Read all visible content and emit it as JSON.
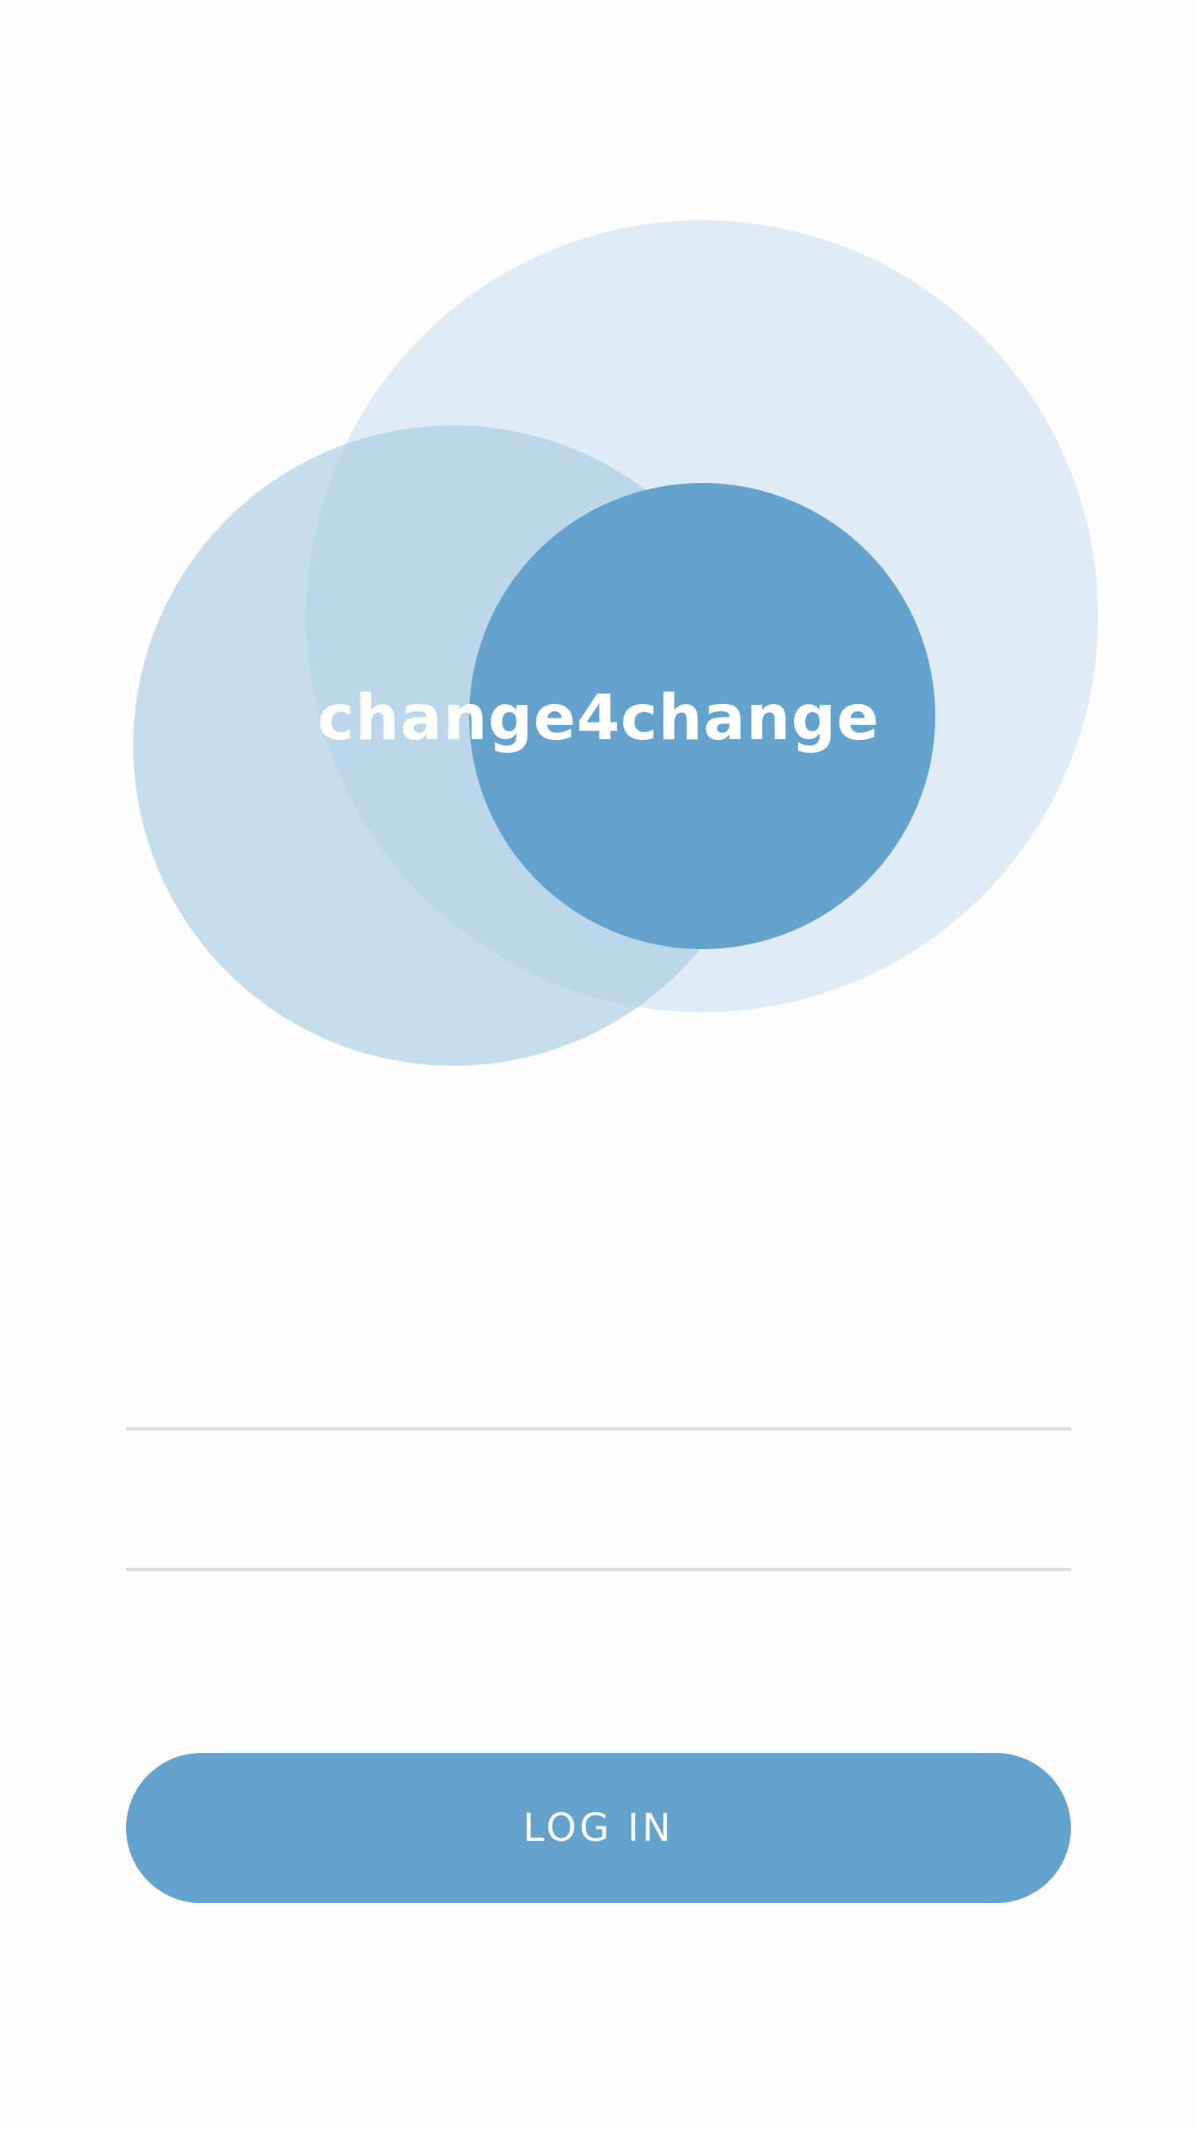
{
  "app": {
    "name": "change4change"
  },
  "colors": {
    "background": "#fdfdfd",
    "primary": "#62a2cd",
    "circle_light": "#dfebf5",
    "circle_medium": "#c3dcec",
    "circle_overlap": "#b0d0e7",
    "field_underline": "#dcdcdc",
    "text_on_primary": "#ffffff"
  },
  "login_form": {
    "username_value": "",
    "password_value": "",
    "submit_label": "LOG IN"
  }
}
